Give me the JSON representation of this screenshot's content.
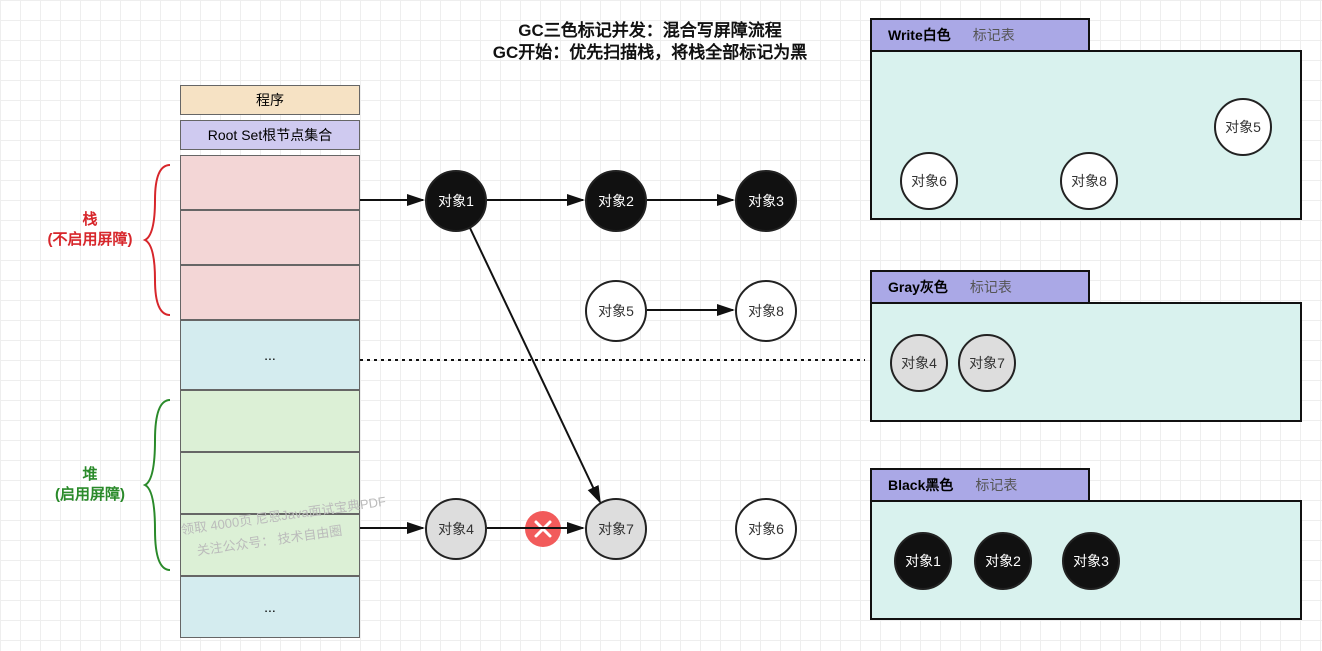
{
  "title": {
    "line1": "GC三色标记并发：混合写屏障流程",
    "line2": "GC开始：优先扫描栈，将栈全部标记为黑"
  },
  "sidelabels": {
    "stack_line1": "栈",
    "stack_line2": "(不启用屏障)",
    "heap_line1": "堆",
    "heap_line2": "(启用屏障)"
  },
  "program_column": {
    "program": "程序",
    "rootset": "Root Set根节点集合",
    "dots": "..."
  },
  "objects": {
    "o1": "对象1",
    "o2": "对象2",
    "o3": "对象3",
    "o4": "对象4",
    "o5": "对象5",
    "o6": "对象6",
    "o7": "对象7",
    "o8": "对象8"
  },
  "tables": {
    "white": {
      "title_bold": "Write白色",
      "title_gray": "标记表",
      "items": [
        "对象6",
        "对象8",
        "对象5"
      ]
    },
    "gray": {
      "title_bold": "Gray灰色",
      "title_gray": "标记表",
      "items": [
        "对象4",
        "对象7"
      ]
    },
    "black": {
      "title_bold": "Black黑色",
      "title_gray": "标记表",
      "items": [
        "对象1",
        "对象2",
        "对象3"
      ]
    }
  },
  "watermark": {
    "line1": "领取 4000页 尼恩Java面试宝典PDF",
    "line2": "关注公众号：  技术自由圈"
  },
  "colors": {
    "red": "#d7262b",
    "green": "#2a8a2a",
    "table_bg": "#d9f2ee",
    "table_head": "#aaa8e6",
    "cross": "#f25b5b"
  }
}
